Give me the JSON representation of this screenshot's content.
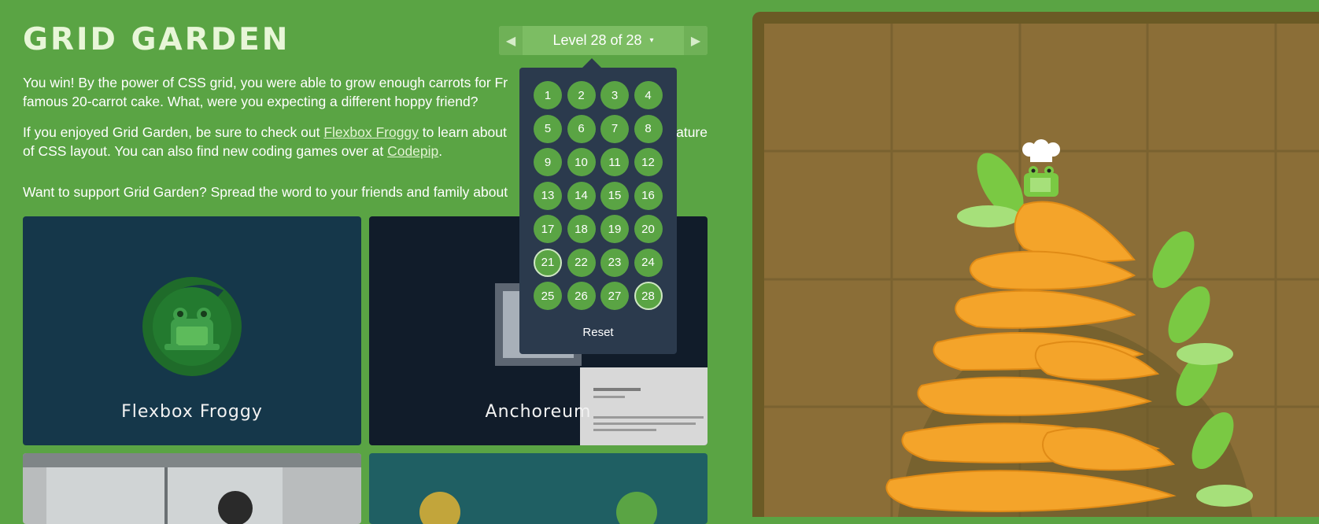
{
  "title": "GRID GARDEN",
  "level_nav": {
    "text": "Level 28 of 28",
    "caret": "▾",
    "prev": "◀",
    "next": "▶"
  },
  "paragraphs": {
    "p1": "You win! By the power of CSS grid, you were able to grow enough carrots for Fr",
    "p1b": "famous 20-carrot cake. What, were you expecting a different hoppy friend?",
    "p2a": "If you enjoyed Grid Garden, be sure to check out ",
    "p2_link1": "Flexbox Froggy",
    "p2b": " to learn about ",
    "p2c": "ature",
    "p2d": "of CSS layout. You can also find new coding games over at ",
    "p2_link2": "Codepip",
    "p2e": ".",
    "p3": "Want to support Grid Garden? Spread the word to your friends and family about"
  },
  "levels": [
    "1",
    "2",
    "3",
    "4",
    "5",
    "6",
    "7",
    "8",
    "9",
    "10",
    "11",
    "12",
    "13",
    "14",
    "15",
    "16",
    "17",
    "18",
    "19",
    "20",
    "21",
    "22",
    "23",
    "24",
    "25",
    "26",
    "27",
    "28"
  ],
  "completed_levels": [
    "21",
    "28"
  ],
  "reset_label": "Reset",
  "cards": {
    "froggy": "Flexbox Froggy",
    "anchoreum": "Anchoreum"
  },
  "colors": {
    "background": "#5aa444",
    "dropdown": "#2b3a4d",
    "soil": "#8b6e37",
    "carrot": "#f4a42a"
  }
}
